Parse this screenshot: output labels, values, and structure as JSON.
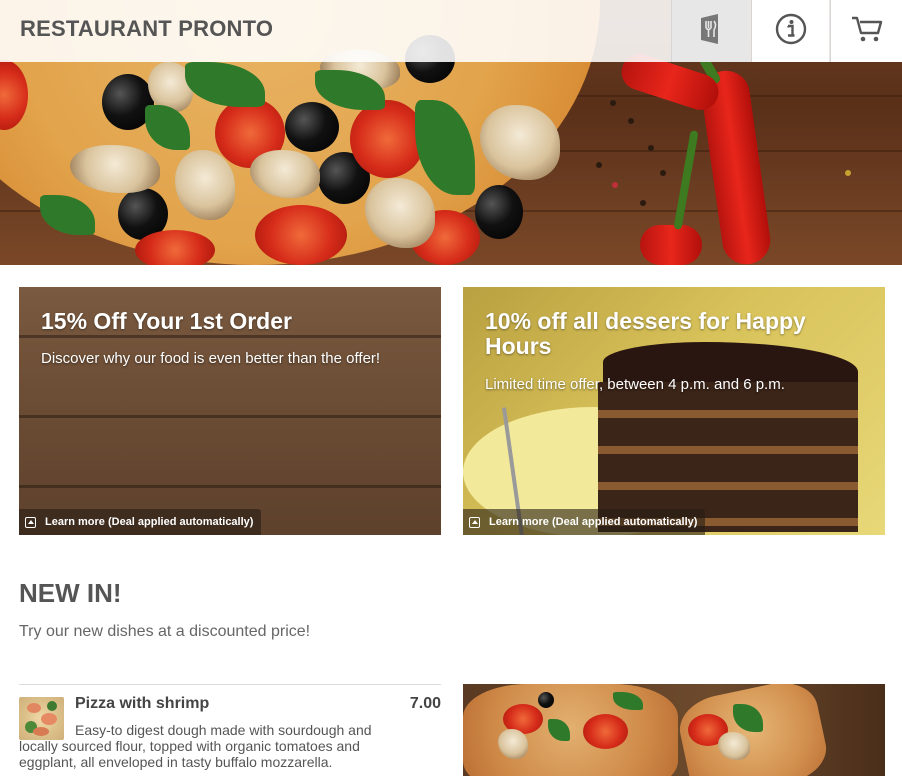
{
  "header": {
    "brand": "RESTAURANT PRONTO",
    "icons": [
      "menu-icon",
      "info-icon",
      "cart-icon"
    ]
  },
  "promos": [
    {
      "title": "15% Off Your 1st Order",
      "text": "Discover why our food is even better than the offer!",
      "learn_more": "Learn more (Deal applied automatically)"
    },
    {
      "title": "10% off all dessers for Happy Hours",
      "text": "Limited time offer, between 4 p.m. and 6 p.m.",
      "learn_more": "Learn more (Deal applied automatically)"
    }
  ],
  "new_in": {
    "title": "NEW IN!",
    "subtitle": "Try our new dishes at a discounted price!",
    "items": [
      {
        "name": "Pizza with shrimp",
        "price": "7.00",
        "description": "Easy-to digest dough made with sourdough and locally sourced flour, topped with organic tomatoes and eggplant, all enveloped in tasty buffalo mozzarella."
      }
    ]
  },
  "colors": {
    "header_bg": "#ffffff",
    "active_nav_bg": "#e7e7e7",
    "text_dark": "#444444"
  }
}
